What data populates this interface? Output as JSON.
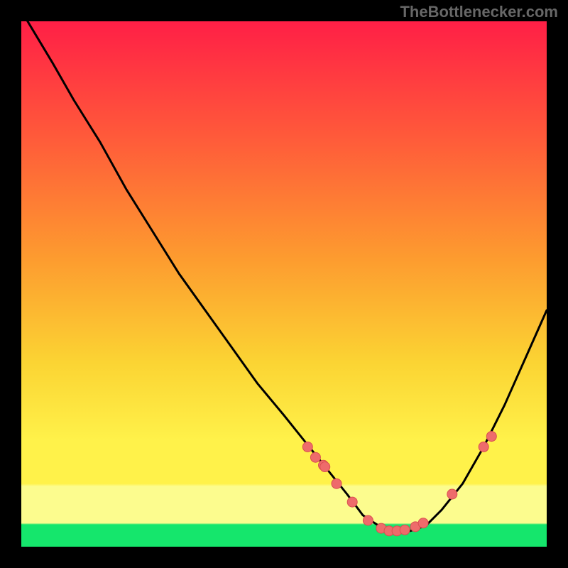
{
  "attribution": "TheBottlenecker.com",
  "colors": {
    "top": "#ff1f46",
    "band_yellow": "#fff24a",
    "band_light_yellow": "#fcfc8e",
    "band_green": "#15e66c",
    "curve": "#000000",
    "marker_fill": "#ee6b6b",
    "marker_stroke": "#d94f4f"
  },
  "chart_data": {
    "type": "line",
    "title": "",
    "xlabel": "",
    "ylabel": "",
    "xlim": [
      0,
      100
    ],
    "ylim": [
      0,
      100
    ],
    "curve": {
      "x": [
        0,
        3,
        6,
        10,
        15,
        20,
        25,
        30,
        35,
        40,
        45,
        50,
        54,
        58,
        62,
        65,
        68,
        71,
        74,
        77,
        80,
        84,
        88,
        92,
        96,
        100
      ],
      "y": [
        102,
        97,
        92,
        85,
        77,
        68,
        60,
        52,
        45,
        38,
        31,
        25,
        20,
        15,
        10,
        6,
        4,
        3,
        3,
        4,
        7,
        12,
        19,
        27,
        36,
        45
      ]
    },
    "series": [
      {
        "name": "points",
        "x": [
          54.5,
          56,
          57.5,
          57.8,
          60,
          63,
          66,
          68.5,
          70,
          71.5,
          73,
          75,
          76.5,
          82,
          88,
          89.5
        ],
        "y": [
          19,
          17,
          15.5,
          15.2,
          12,
          8.5,
          5,
          3.5,
          3,
          3,
          3.2,
          3.8,
          4.5,
          10,
          19,
          21
        ]
      }
    ]
  }
}
